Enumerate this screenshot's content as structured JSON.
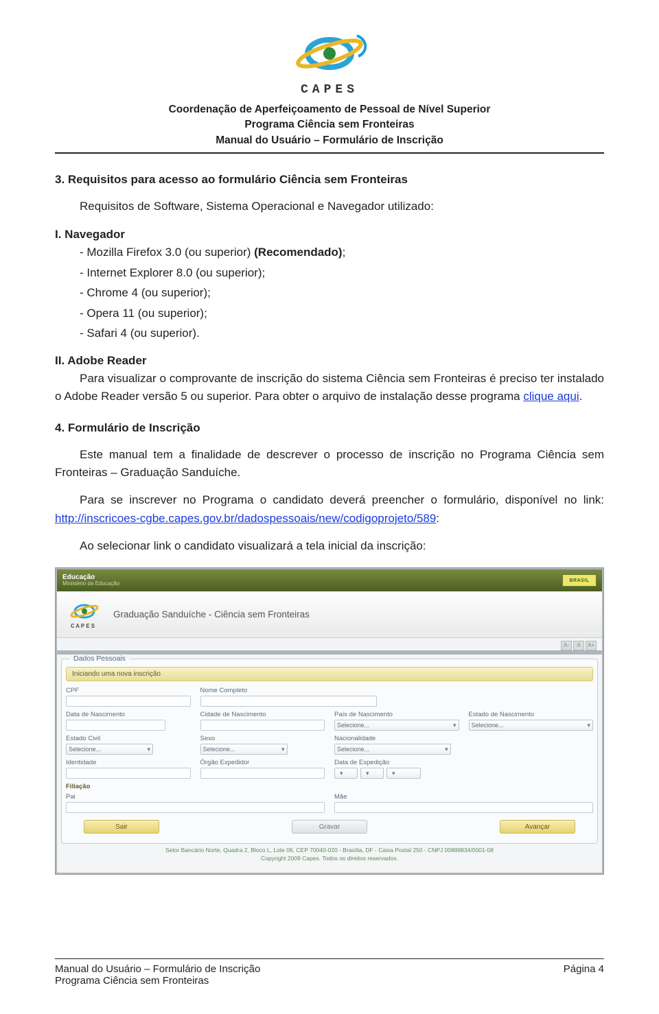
{
  "logo_text": "CAPES",
  "header": {
    "line1": "Coordenação de Aperfeiçoamento de Pessoal de Nível Superior",
    "line2": "Programa Ciência sem Fronteiras",
    "line3": "Manual do Usuário – Formulário de Inscrição"
  },
  "s3": {
    "title": "3.  Requisitos para acesso ao formulário Ciência sem Fronteiras",
    "intro": "Requisitos de Software, Sistema Operacional e Navegador utilizado:",
    "i_title": "I.  Navegador",
    "i_items": {
      "a": "- Mozilla Firefox 3.0 (ou superior) ",
      "a_bold": "(Recomendado)",
      "a_tail": ";",
      "b": "- Internet Explorer 8.0 (ou superior);",
      "c": "- Chrome 4 (ou superior);",
      "d": "- Opera 11 (ou superior);",
      "e": "- Safari 4 (ou superior)."
    },
    "ii_title": "II.  Adobe Reader",
    "ii_body_a": "Para visualizar o comprovante de inscrição do sistema Ciência sem Fronteiras é preciso ter instalado o Adobe Reader versão 5 ou superior. Para obter o arquivo de instalação desse programa ",
    "ii_link": "clique aqui",
    "ii_tail": "."
  },
  "s4": {
    "title": "4.  Formulário de Inscrição",
    "p1": "Este manual tem a finalidade de descrever o processo de inscrição no Programa Ciência sem Fronteiras – Graduação Sanduíche.",
    "p2a": "Para se inscrever no Programa o candidato deverá preencher o formulário, disponível no link: ",
    "p2_link": "http://inscricoes-cgbe.capes.gov.br/dadospessoais/new/codigoprojeto/589",
    "p2_tail": ":",
    "p3": "Ao selecionar link o candidato visualizará a tela inicial da inscrição:"
  },
  "screenshot": {
    "topbar": {
      "l1": "Educação",
      "l2": "Ministério da Educação",
      "brasil": "BRASIL"
    },
    "title": "Graduação Sanduíche - Ciência sem Fronteiras",
    "fontsizes": [
      "A-",
      "A",
      "A+"
    ],
    "fieldset_legend": "Dados Pessoais",
    "ribbon": "Iniciando uma nova inscrição",
    "labels": {
      "cpf": "CPF",
      "nome": "Nome Completo",
      "data_nasc": "Data de Nascimento",
      "cidade_nasc": "Cidade de Nascimento",
      "pais_nasc": "País de Nascimento",
      "estado_nasc": "Estado de Nascimento",
      "estado_civil": "Estado Civil",
      "sexo": "Sexo",
      "nacionalidade": "Nacionalidade",
      "identidade": "Identidade",
      "orgao": "Órgão Expedidor",
      "data_exp": "Data de Expedição",
      "filiacao": "Filiação",
      "pai": "Pai",
      "mae": "Mãe",
      "selecione": "Selecione..."
    },
    "buttons": {
      "sair": "Sair",
      "gravar": "Gravar",
      "avancar": "Avançar"
    },
    "footer1": "Setor Bancário Norte, Quadra 2, Bloco L, Lote 06, CEP 70040-020 - Brasília, DF - Caixa Postal 250 - CNPJ 00889834/0001-08",
    "footer2": "Copyright 2009 Capes. Todos os direitos reservados."
  },
  "footer": {
    "l1": "Manual do Usuário – Formulário de Inscrição",
    "l2": "Programa Ciência sem Fronteiras",
    "page": "Página 4"
  }
}
